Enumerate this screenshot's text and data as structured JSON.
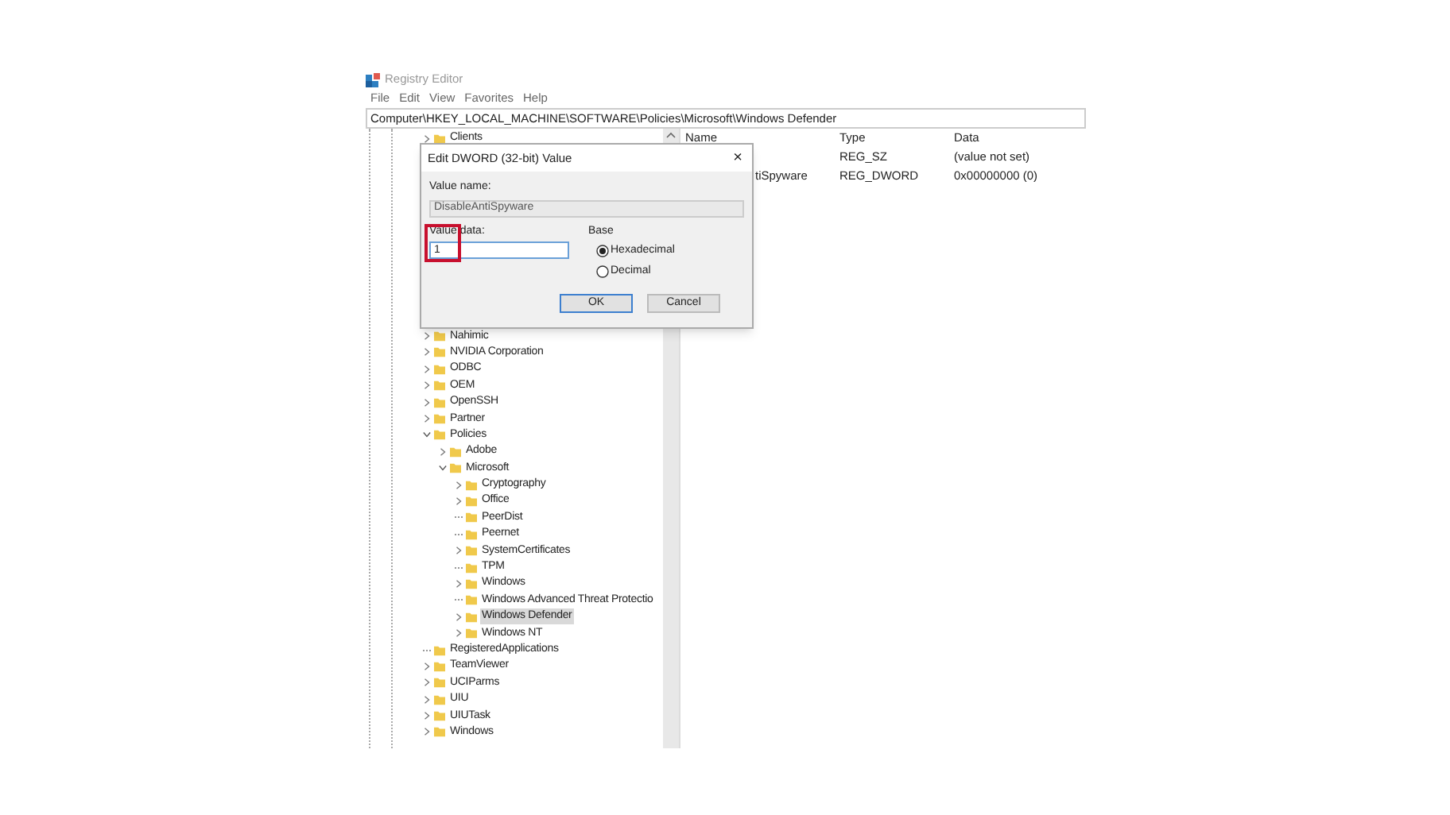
{
  "window": {
    "title": "Registry Editor"
  },
  "menu": [
    "File",
    "Edit",
    "View",
    "Favorites",
    "Help"
  ],
  "address": "Computer\\HKEY_LOCAL_MACHINE\\SOFTWARE\\Policies\\Microsoft\\Windows Defender",
  "tree": [
    {
      "label": "Clients",
      "kind": "node",
      "expanded": false,
      "selected": false
    },
    {
      "kind": "hidden_rows"
    },
    {
      "label": "Nahimic",
      "kind": "node",
      "expanded": false,
      "selected": false
    },
    {
      "label": "NVIDIA Corporation",
      "kind": "node",
      "expanded": false,
      "selected": false
    },
    {
      "label": "ODBC",
      "kind": "node",
      "expanded": false,
      "selected": false
    },
    {
      "label": "OEM",
      "kind": "node",
      "expanded": false,
      "selected": false
    },
    {
      "label": "OpenSSH",
      "kind": "node",
      "expanded": false,
      "selected": false
    },
    {
      "label": "Partner",
      "kind": "node",
      "expanded": false,
      "selected": false
    },
    {
      "label": "Policies",
      "kind": "node",
      "expanded": true,
      "selected": false,
      "children": [
        {
          "label": "Adobe",
          "kind": "node",
          "expanded": false,
          "selected": false
        },
        {
          "label": "Microsoft",
          "kind": "node",
          "expanded": true,
          "selected": false,
          "children": [
            {
              "label": "Cryptography",
              "kind": "node",
              "expanded": false,
              "selected": false
            },
            {
              "label": "Office",
              "kind": "node",
              "expanded": false,
              "selected": false
            },
            {
              "label": "PeerDist",
              "kind": "leaf",
              "selected": false
            },
            {
              "label": "Peernet",
              "kind": "leaf",
              "selected": false
            },
            {
              "label": "SystemCertificates",
              "kind": "node",
              "expanded": false,
              "selected": false
            },
            {
              "label": "TPM",
              "kind": "leaf",
              "selected": false
            },
            {
              "label": "Windows",
              "kind": "node",
              "expanded": false,
              "selected": false
            },
            {
              "label": "Windows Advanced Threat Protectio",
              "kind": "leaf",
              "selected": false
            },
            {
              "label": "Windows Defender",
              "kind": "node",
              "expanded": false,
              "selected": true
            },
            {
              "label": "Windows NT",
              "kind": "node",
              "expanded": false,
              "selected": false
            }
          ]
        }
      ]
    },
    {
      "label": "RegisteredApplications",
      "kind": "leaf",
      "selected": false
    },
    {
      "label": "TeamViewer",
      "kind": "node",
      "expanded": false,
      "selected": false
    },
    {
      "label": "UCIParms",
      "kind": "node",
      "expanded": false,
      "selected": false
    },
    {
      "label": "UIU",
      "kind": "node",
      "expanded": false,
      "selected": false
    },
    {
      "label": "UIUTask",
      "kind": "node",
      "expanded": false,
      "selected": false
    },
    {
      "label": "Windows",
      "kind": "node",
      "expanded": false,
      "selected": false
    }
  ],
  "values": {
    "columns": [
      "Name",
      "Type",
      "Data"
    ],
    "rows": [
      {
        "type": "REG_SZ",
        "data": "(value not set)"
      },
      {
        "name": "tiSpyware",
        "type": "REG_DWORD",
        "data": "0x00000000 (0)"
      }
    ]
  },
  "dialog": {
    "title": "Edit DWORD (32-bit) Value",
    "close": "×",
    "value_name_label": "Value name:",
    "value_name": "DisableAntiSpyware",
    "value_data_label": "Value data:",
    "value_data": "1",
    "value_data_highlighted": true,
    "base_label": "Base",
    "base_options": [
      {
        "label": "Hexadecimal",
        "selected": true
      },
      {
        "label": "Decimal",
        "selected": false
      }
    ],
    "buttons": [
      {
        "label": "OK",
        "default": true
      },
      {
        "label": "Cancel",
        "default": false
      }
    ]
  }
}
